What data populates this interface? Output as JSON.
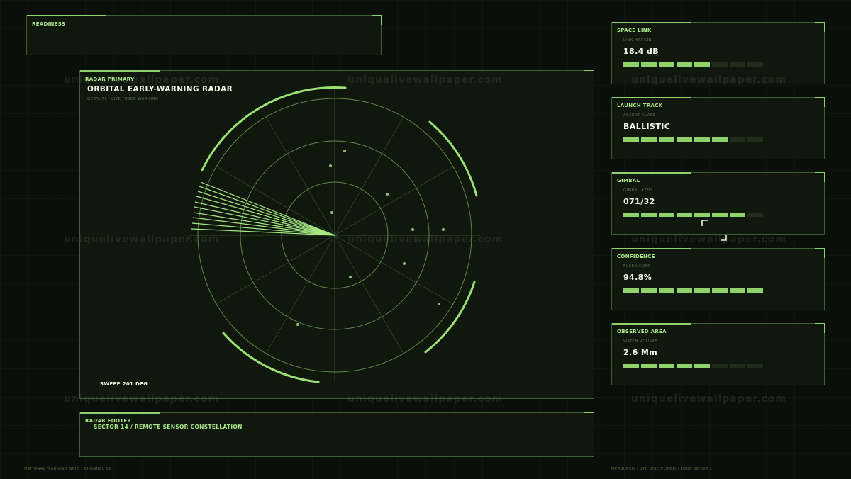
{
  "readiness": {
    "label": "READINESS"
  },
  "radar": {
    "label": "RADAR PRIMARY",
    "title": "ORBITAL EARLY-WARNING RADAR",
    "subtitle": "OEWR-71 / LIVE FUSED WARNING",
    "sweep": "SWEEP 201 DEG"
  },
  "footer_panel": {
    "label": "RADAR FOOTER",
    "text": "SECTOR 14 / REMOTE SENSOR CONSTELLATION"
  },
  "side_panels": [
    {
      "label": "SPACE LINK",
      "sublabel": "LINK MARGIN",
      "value": "18.4 dB",
      "segments_on": 5,
      "segments_total": 8
    },
    {
      "label": "LAUNCH TRACK",
      "sublabel": "ASCENT CLASS",
      "value": "BALLISTIC",
      "segments_on": 6,
      "segments_total": 8
    },
    {
      "label": "GIMBAL",
      "sublabel": "GIMBAL AZ/EL",
      "value": "071/32",
      "segments_on": 7,
      "segments_total": 8
    },
    {
      "label": "CONFIDENCE",
      "sublabel": "FUSED CONF",
      "value": "94.8%",
      "segments_on": 8,
      "segments_total": 8
    },
    {
      "label": "OBSERVED AREA",
      "sublabel": "WATCH VOLUME",
      "value": "2.6 Mm",
      "segments_on": 5,
      "segments_total": 8
    }
  ],
  "status": {
    "left": "NATIONAL WARNING GRID / CHANNEL 01",
    "right": "MEASURED / UTC DISCIPLINED / LOOP 38.000 s"
  },
  "watermark": "uniquelivewallpaper.com",
  "colors": {
    "accent": "#8fd16a",
    "border": "#3f5e33",
    "background": "#0b0f0a"
  }
}
